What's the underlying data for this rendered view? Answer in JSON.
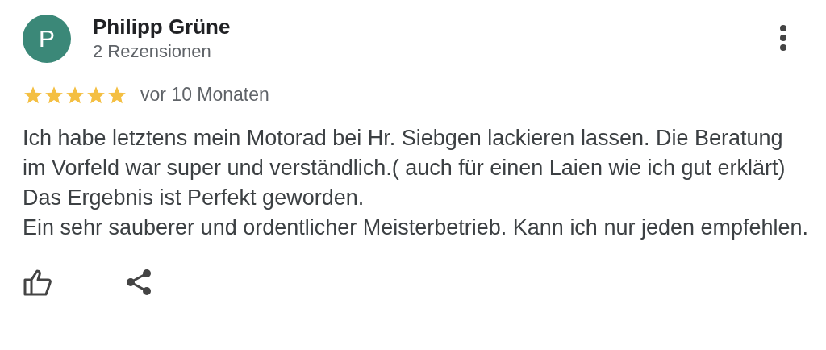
{
  "review": {
    "author": {
      "initial": "P",
      "name": "Philipp Grüne",
      "review_count": "2 Rezensionen",
      "color": "#3b8878"
    },
    "stars": 5,
    "time": "vor 10 Monaten",
    "paragraphs": [
      "Ich habe letztens mein Motorad bei Hr. Siebgen lackieren lassen. Die Beratung im Vorfeld war super und verständlich.( auch für einen Laien wie ich gut erklärt) Das Ergebnis ist Perfekt geworden.",
      "Ein sehr sauberer und ordentlicher Meisterbetrieb. Kann ich nur jeden empfehlen."
    ]
  }
}
